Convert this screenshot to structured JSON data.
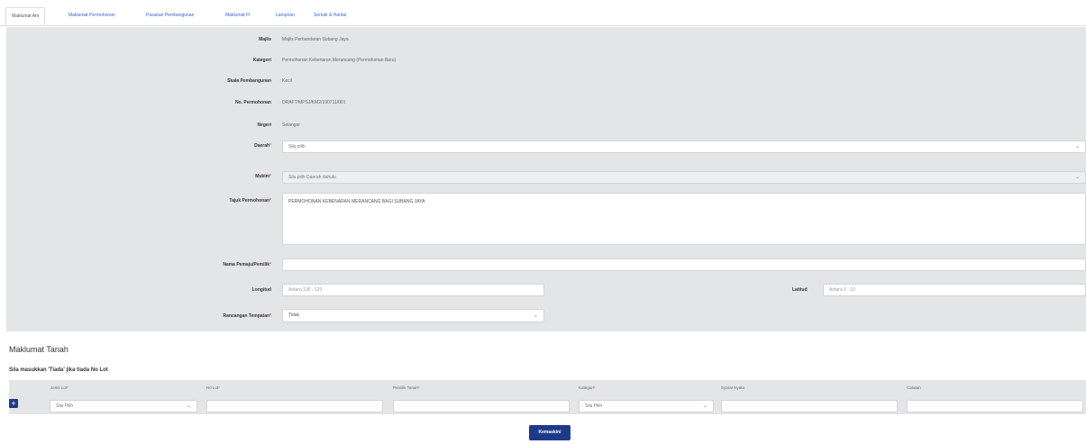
{
  "tabs": [
    {
      "label": "Maklumat Am",
      "active": true
    },
    {
      "label": "Maklumat Permohonan",
      "active": false
    },
    {
      "label": "Pasukan Pembangunan",
      "active": false
    },
    {
      "label": "Maklumat FI",
      "active": false
    },
    {
      "label": "Lampiran",
      "active": false
    },
    {
      "label": "Semak & Hantar",
      "active": false
    }
  ],
  "form": {
    "majlis": {
      "label": "Majlis",
      "value": "Majlis Perbandaran Subang Jaya"
    },
    "kategori": {
      "label": "Kategori",
      "value": "Permohonan Kebenaran Merancang (Permohonan Baru)"
    },
    "skala": {
      "label": "Skala Pembangunan",
      "value": "Kecil"
    },
    "no_permohonan": {
      "label": "No. Permohonan",
      "value": "DRAFT/MPSJ/KM2/190711/001"
    },
    "negeri": {
      "label": "Negeri",
      "value": "Selangor"
    },
    "daerah": {
      "label": "Daerah",
      "placeholder": "Sila pilih"
    },
    "mukim": {
      "label": "Mukim",
      "placeholder": "Sila pilih Daerah dahulu"
    },
    "tajuk": {
      "label": "Tajuk Permohonan",
      "value": "PERMOHONAN KEBENARAN MERANCANG BAGI SUBANG JAYA"
    },
    "nama_pemaju": {
      "label": "Nama Pemaju/Pemilik",
      "value": ""
    },
    "longitud": {
      "label": "Longitud",
      "placeholder": "Antara 100 - 120"
    },
    "latitud": {
      "label": "Latitud",
      "placeholder": "Antara 0 - 10"
    },
    "rancangan": {
      "label": "Rancangan Tempatan",
      "value": "Tidak"
    }
  },
  "tanah": {
    "title": "Maklumat Tanah",
    "subtitle": "Sila masukkan 'Tiada' jika tiada No Lot",
    "columns": [
      {
        "label": "Jenis Lot",
        "required": true
      },
      {
        "label": "No Lot",
        "required": true
      },
      {
        "label": "Pemilik Tanah",
        "required": true
      },
      {
        "label": "Kategori",
        "required": true
      },
      {
        "label": "Syarat Nyata",
        "required": false
      },
      {
        "label": "Catatan",
        "required": false
      }
    ],
    "row": {
      "jenis_lot": "Sila Pilih",
      "kategori": "Sila Pilih"
    },
    "add_icon": "plus-icon",
    "update_button": "Kemaskini"
  },
  "colors": {
    "accent": "#1e3a8a",
    "panel": "#e4e5e7",
    "tab_link": "#3b67c9",
    "required": "#d9534f"
  }
}
